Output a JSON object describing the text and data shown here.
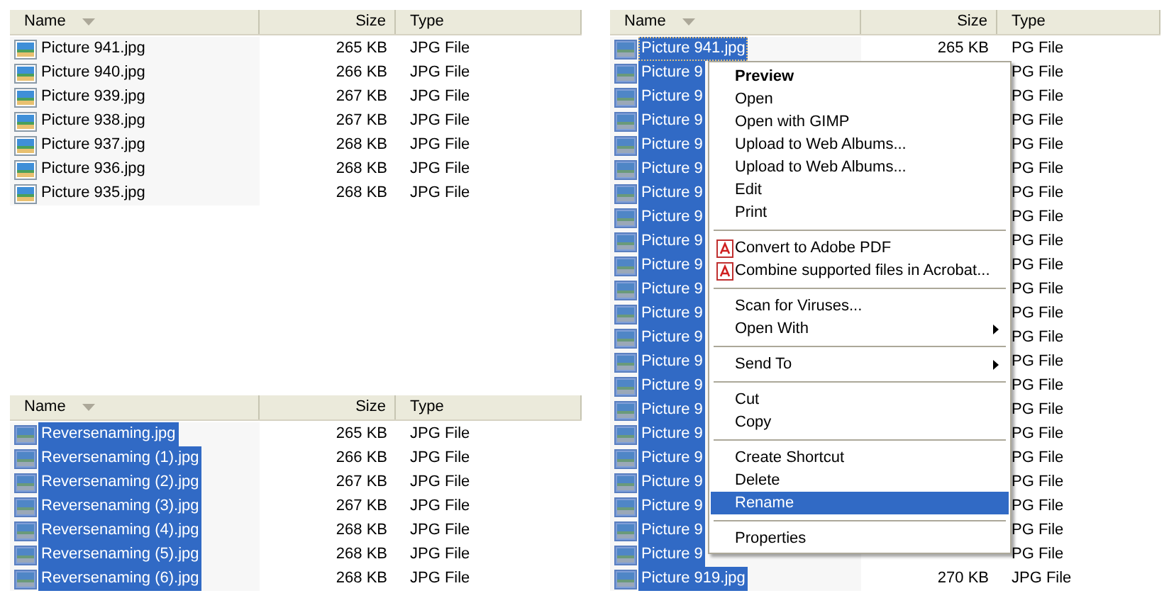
{
  "panels": [
    {
      "columns": [
        {
          "label": "Name",
          "sorted": true
        },
        {
          "label": "Size",
          "sorted": false
        },
        {
          "label": "Type",
          "sorted": false
        }
      ],
      "rows": [
        {
          "name": "Picture 941.jpg",
          "size": "265 KB",
          "type": "JPG File",
          "selected": false,
          "focused": false
        },
        {
          "name": "Picture 940.jpg",
          "size": "266 KB",
          "type": "JPG File",
          "selected": false,
          "focused": false
        },
        {
          "name": "Picture 939.jpg",
          "size": "267 KB",
          "type": "JPG File",
          "selected": false,
          "focused": false
        },
        {
          "name": "Picture 938.jpg",
          "size": "267 KB",
          "type": "JPG File",
          "selected": false,
          "focused": false
        },
        {
          "name": "Picture 937.jpg",
          "size": "268 KB",
          "type": "JPG File",
          "selected": false,
          "focused": false
        },
        {
          "name": "Picture 936.jpg",
          "size": "268 KB",
          "type": "JPG File",
          "selected": false,
          "focused": false
        },
        {
          "name": "Picture 935.jpg",
          "size": "268 KB",
          "type": "JPG File",
          "selected": false,
          "focused": false
        }
      ]
    },
    {
      "columns": [
        {
          "label": "Name",
          "sorted": true
        },
        {
          "label": "Size",
          "sorted": false
        },
        {
          "label": "Type",
          "sorted": false
        }
      ],
      "rows": [
        {
          "name": "Reversenaming.jpg",
          "size": "265 KB",
          "type": "JPG File",
          "selected": true,
          "focused": false
        },
        {
          "name": "Reversenaming (1).jpg",
          "size": "266 KB",
          "type": "JPG File",
          "selected": true,
          "focused": false
        },
        {
          "name": "Reversenaming (2).jpg",
          "size": "267 KB",
          "type": "JPG File",
          "selected": true,
          "focused": false
        },
        {
          "name": "Reversenaming (3).jpg",
          "size": "267 KB",
          "type": "JPG File",
          "selected": true,
          "focused": false
        },
        {
          "name": "Reversenaming (4).jpg",
          "size": "268 KB",
          "type": "JPG File",
          "selected": true,
          "focused": false
        },
        {
          "name": "Reversenaming (5).jpg",
          "size": "268 KB",
          "type": "JPG File",
          "selected": true,
          "focused": false
        },
        {
          "name": "Reversenaming (6).jpg",
          "size": "268 KB",
          "type": "JPG File",
          "selected": true,
          "focused": false
        }
      ]
    },
    {
      "columns": [
        {
          "label": "Name",
          "sorted": true
        },
        {
          "label": "Size",
          "sorted": false
        },
        {
          "label": "Type",
          "sorted": false
        }
      ],
      "rows": [
        {
          "name": "Picture 941.jpg",
          "size": "265 KB",
          "type": "PG File",
          "selected": true,
          "focused": true
        },
        {
          "name": "Picture 9",
          "type": "PG File",
          "selected": true,
          "focused": false
        },
        {
          "name": "Picture 9",
          "type": "PG File",
          "selected": true,
          "focused": false
        },
        {
          "name": "Picture 9",
          "type": "PG File",
          "selected": true,
          "focused": false
        },
        {
          "name": "Picture 9",
          "type": "PG File",
          "selected": true,
          "focused": false
        },
        {
          "name": "Picture 9",
          "type": "PG File",
          "selected": true,
          "focused": false
        },
        {
          "name": "Picture 9",
          "type": "PG File",
          "selected": true,
          "focused": false
        },
        {
          "name": "Picture 9",
          "type": "PG File",
          "selected": true,
          "focused": false
        },
        {
          "name": "Picture 9",
          "type": "PG File",
          "selected": true,
          "focused": false
        },
        {
          "name": "Picture 9",
          "type": "PG File",
          "selected": true,
          "focused": false
        },
        {
          "name": "Picture 9",
          "type": "PG File",
          "selected": true,
          "focused": false
        },
        {
          "name": "Picture 9",
          "type": "PG File",
          "selected": true,
          "focused": false
        },
        {
          "name": "Picture 9",
          "type": "PG File",
          "selected": true,
          "focused": false
        },
        {
          "name": "Picture 9",
          "type": "PG File",
          "selected": true,
          "focused": false
        },
        {
          "name": "Picture 9",
          "type": "PG File",
          "selected": true,
          "focused": false
        },
        {
          "name": "Picture 9",
          "type": "PG File",
          "selected": true,
          "focused": false
        },
        {
          "name": "Picture 9",
          "type": "PG File",
          "selected": true,
          "focused": false
        },
        {
          "name": "Picture 9",
          "type": "PG File",
          "selected": true,
          "focused": false
        },
        {
          "name": "Picture 9",
          "type": "PG File",
          "selected": true,
          "focused": false
        },
        {
          "name": "Picture 9",
          "type": "PG File",
          "selected": true,
          "focused": false
        },
        {
          "name": "Picture 9",
          "type": "PG File",
          "selected": true,
          "focused": false
        },
        {
          "name": "Picture 9",
          "type": "PG File",
          "selected": true,
          "focused": false
        },
        {
          "name": "Picture 919.jpg",
          "size": "270 KB",
          "type": "JPG File",
          "selected": true,
          "focused": false
        }
      ],
      "context_menu": {
        "items": [
          {
            "kind": "item",
            "label": "Preview",
            "default": true,
            "submenu": false,
            "selected": false
          },
          {
            "kind": "item",
            "label": "Open",
            "default": false,
            "submenu": false,
            "selected": false
          },
          {
            "kind": "item",
            "label": "Open with GIMP",
            "default": false,
            "submenu": false,
            "selected": false
          },
          {
            "kind": "item",
            "label": "Upload to Web Albums...",
            "default": false,
            "submenu": false,
            "selected": false
          },
          {
            "kind": "item",
            "label": "Upload to Web Albums...",
            "default": false,
            "submenu": false,
            "selected": false
          },
          {
            "kind": "item",
            "label": "Edit",
            "default": false,
            "submenu": false,
            "selected": false
          },
          {
            "kind": "item",
            "label": "Print",
            "default": false,
            "submenu": false,
            "selected": false
          },
          {
            "kind": "separator"
          },
          {
            "kind": "icon_item",
            "label": "Convert to Adobe PDF",
            "default": false,
            "submenu": false,
            "selected": false
          },
          {
            "kind": "icon_item",
            "label": "Combine supported files in Acrobat...",
            "default": false,
            "submenu": false,
            "selected": false
          },
          {
            "kind": "separator"
          },
          {
            "kind": "item",
            "label": "Scan for Viruses...",
            "default": false,
            "submenu": false,
            "selected": false
          },
          {
            "kind": "item",
            "label": "Open With",
            "default": false,
            "submenu": true,
            "selected": false
          },
          {
            "kind": "separator"
          },
          {
            "kind": "item",
            "label": "Send To",
            "default": false,
            "submenu": true,
            "selected": false
          },
          {
            "kind": "separator"
          },
          {
            "kind": "item",
            "label": "Cut",
            "default": false,
            "submenu": false,
            "selected": false
          },
          {
            "kind": "item",
            "label": "Copy",
            "default": false,
            "submenu": false,
            "selected": false
          },
          {
            "kind": "separator"
          },
          {
            "kind": "item",
            "label": "Create Shortcut",
            "default": false,
            "submenu": false,
            "selected": false
          },
          {
            "kind": "item",
            "label": "Delete",
            "default": false,
            "submenu": false,
            "selected": false
          },
          {
            "kind": "item",
            "label": "Rename",
            "default": false,
            "submenu": false,
            "selected": true
          },
          {
            "kind": "separator"
          },
          {
            "kind": "item",
            "label": "Properties",
            "default": false,
            "submenu": false,
            "selected": false
          }
        ]
      }
    }
  ]
}
